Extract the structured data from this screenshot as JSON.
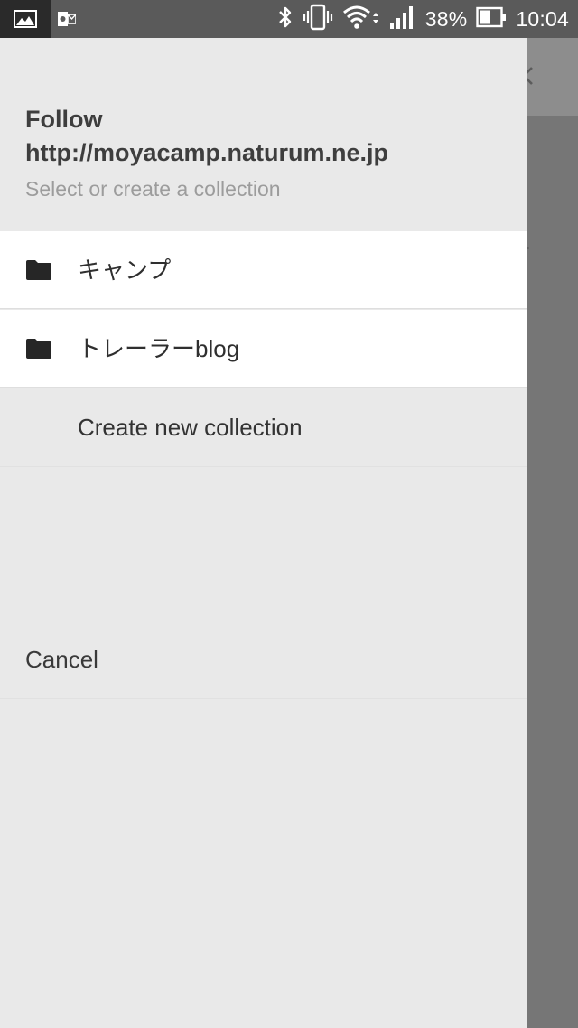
{
  "status_bar": {
    "left_icons": [
      "gallery-notification-icon",
      "outlook-notification-icon"
    ],
    "right_icons": [
      "bluetooth-icon",
      "vibrate-icon",
      "wifi-icon",
      "signal-icon",
      "battery-icon"
    ],
    "battery_percent": "38%",
    "time": "10:04"
  },
  "background_app": {
    "icons": [
      "back-arrow-icon"
    ]
  },
  "sheet": {
    "title_line1": "Follow",
    "title_line2": "http://moyacamp.naturum.ne.jp",
    "subtitle": "Select or create a collection",
    "collections": [
      {
        "label": "キャンプ",
        "icon": "folder-icon"
      },
      {
        "label": "トレーラーblog",
        "icon": "folder-icon"
      }
    ],
    "create_label": "Create new collection",
    "cancel_label": "Cancel"
  },
  "colors": {
    "status_bar_bg": "#5a5a5a",
    "sheet_bg": "#e9e9e9",
    "row_bg": "#ffffff",
    "scrim": "#767676",
    "title_text": "#3e3e3e",
    "subtitle_text": "#9c9c9c"
  }
}
